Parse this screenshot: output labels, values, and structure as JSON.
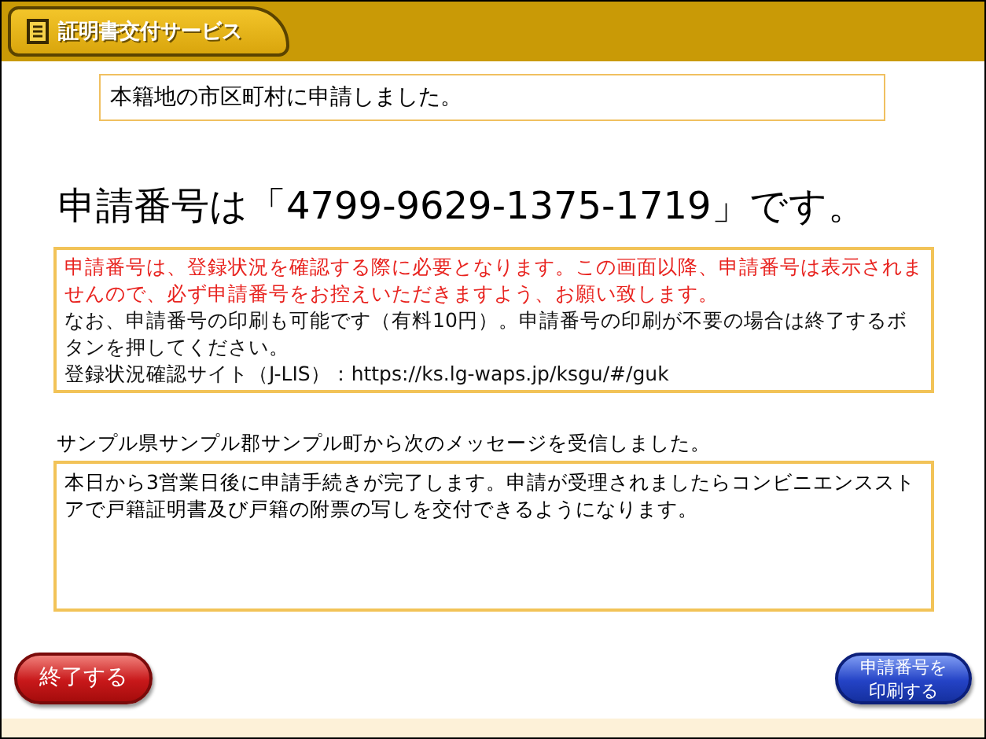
{
  "header": {
    "title": "証明書交付サービス"
  },
  "notice": "本籍地の市区町村に申請しました。",
  "heading": "申請番号は「4799-9629-1375-1719」です。",
  "info": {
    "warning": "申請番号は、登録状況を確認する際に必要となります。この画面以降、申請番号は表示されませんので、必ず申請番号をお控えいただきますよう、お願い致します。",
    "note": "なお、申請番号の印刷も可能です（有料10円）。申請番号の印刷が不要の場合は終了するボタンを押してください。",
    "site": "登録状況確認サイト（J-LIS）：https://ks.lg-waps.jp/ksgu/#/guk"
  },
  "message": {
    "label": "サンプル県サンプル郡サンプル町から次のメッセージを受信しました。",
    "body": "本日から3営業日後に申請手続きが完了します。申請が受理されましたらコンビニエンスストアで戸籍証明書及び戸籍の附票の写しを交付できるようになります。"
  },
  "buttons": [
    {
      "label": "終了する",
      "kind": "exit"
    },
    {
      "label": "申請番号を印刷する",
      "kind": "print"
    }
  ]
}
